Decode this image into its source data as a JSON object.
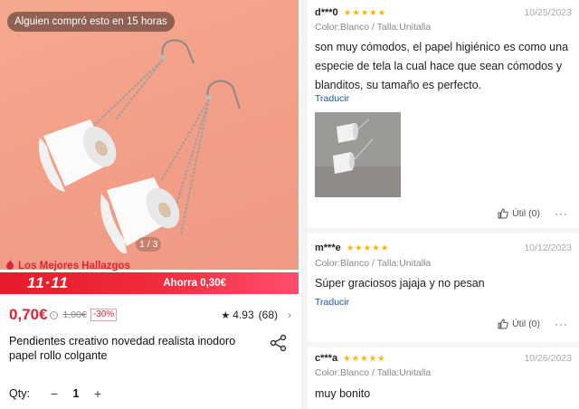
{
  "product": {
    "toast": "Alguien compró esto en 15 horas",
    "image_counter": "1 / 3",
    "promo_label": "Los Mejores Hallazgos",
    "promo_brand": "11·11",
    "promo_discount": "Ahorra 0,30€",
    "price": "0,70€",
    "info_icon": "i",
    "old_price": "1,00€",
    "discount_badge": "-30%",
    "rating": "4.93",
    "rating_count": "(68)",
    "title": "Pendientes creativo novedad realista inodoro papel rollo colgante",
    "qty_label": "Qty:",
    "qty_minus": "−",
    "qty_value": "1",
    "qty_plus": "+"
  },
  "reviews": [
    {
      "user": "d***0",
      "stars": "★★★★★",
      "date": "10/25/2023",
      "text": "son muy cómodos, el papel higiénico es como una especie de tela la cual hace que sean cómodos y blanditos, su tamaño es perfecto.",
      "translate": "Traducir",
      "useful": "Útil (0)"
    },
    {
      "user": "m***e",
      "stars": "★★★★★",
      "date": "10/12/2023",
      "variant": "Color:Blanco / Talla:Unitalla",
      "text": "Súper graciosos jajaja y no pesan",
      "translate": "Traducir",
      "useful": "Útil (0)"
    },
    {
      "user": "c***a",
      "stars": "★★★★★",
      "date": "10/26/2023",
      "variant": "Color:Blanco / Talla:Unitalla",
      "text": "muy bonito"
    }
  ],
  "reviews_first_variant": "Color:Blanco / Talla:Unitalla",
  "colors": {
    "accent_red": "#e4223a",
    "star_yellow": "#ffb300",
    "link_blue": "#1a56b3"
  },
  "icons": [
    "info-icon",
    "star-icon",
    "chevron-right-icon",
    "share-icon",
    "thumbs-up-icon",
    "more-icon",
    "fire-icon"
  ]
}
